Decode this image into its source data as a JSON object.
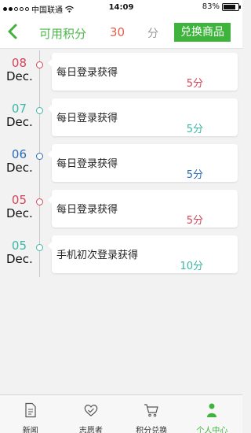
{
  "status": {
    "carrier": "中国联通",
    "time": "14:09",
    "battery": "83%",
    "battery_level": 0.83
  },
  "header": {
    "label": "可用积分",
    "points": "30",
    "unit": "分",
    "exchange_button": "兑换商品"
  },
  "colors": {
    "accent": "#3fb43d",
    "red": "#d2455a",
    "teal": "#3bb7a7",
    "blue": "#2b6cb3"
  },
  "records": [
    {
      "day": "08",
      "month": "Dec.",
      "title": "每日登录获得",
      "points": "5分",
      "color": "#d2455a"
    },
    {
      "day": "07",
      "month": "Dec.",
      "title": "每日登录获得",
      "points": "5分",
      "color": "#3bb7a7"
    },
    {
      "day": "06",
      "month": "Dec.",
      "title": "每日登录获得",
      "points": "5分",
      "color": "#2b6cb3"
    },
    {
      "day": "05",
      "month": "Dec.",
      "title": "每日登录获得",
      "points": "5分",
      "color": "#d2455a"
    },
    {
      "day": "05",
      "month": "Dec.",
      "title": "手机初次登录获得",
      "points": "10分",
      "color": "#3bb7a7"
    }
  ],
  "tabs": [
    {
      "label": "新闻",
      "icon": "document-icon"
    },
    {
      "label": "志愿者",
      "icon": "heart-icon"
    },
    {
      "label": "积分兑换",
      "icon": "cart-icon"
    },
    {
      "label": "个人中心",
      "icon": "person-icon",
      "active": true
    }
  ]
}
